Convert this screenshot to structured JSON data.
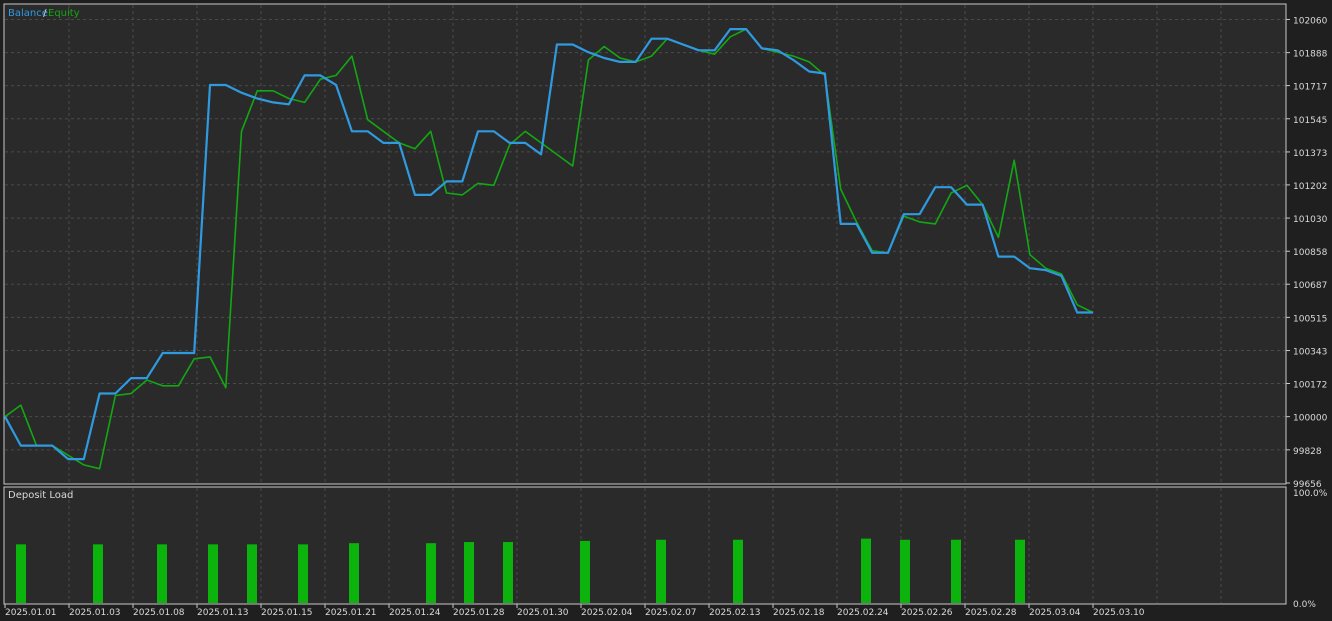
{
  "legend": {
    "balance": "Balance",
    "sep": " / ",
    "equity": "Equity"
  },
  "panel2_title": "Deposit Load",
  "colors": {
    "balance": "#2f9ae0",
    "equity": "#13a813",
    "bars": "#0db30d",
    "background": "#2a2a2a",
    "grid": "#4a4a4a",
    "text": "#d9d9d9"
  },
  "chart_data": [
    {
      "type": "line",
      "ylim": [
        99656,
        102135
      ],
      "y_ticks": [
        102060,
        101888,
        101717,
        101545,
        101373,
        101202,
        101030,
        100858,
        100687,
        100515,
        100343,
        100172,
        100000,
        99828,
        99656
      ],
      "grid": true,
      "legend_position": "top-left",
      "series": [
        {
          "name": "Balance",
          "values": [
            100000,
            99850,
            99850,
            99850,
            99780,
            99780,
            100120,
            100120,
            100200,
            100200,
            100330,
            100330,
            100330,
            101720,
            101720,
            101680,
            101650,
            101630,
            101620,
            101770,
            101770,
            101720,
            101480,
            101480,
            101420,
            101420,
            101150,
            101150,
            101220,
            101220,
            101480,
            101480,
            101420,
            101420,
            101360,
            101930,
            101930,
            101890,
            101860,
            101840,
            101840,
            101960,
            101960,
            101930,
            101900,
            101900,
            102010,
            102010,
            101910,
            101900,
            101850,
            101790,
            101780,
            101000,
            101000,
            100850,
            100850,
            101050,
            101050,
            101190,
            101190,
            101100,
            101100,
            100830,
            100830,
            100770,
            100760,
            100730,
            100540,
            100540
          ]
        },
        {
          "name": "Equity",
          "values": [
            100000,
            100060,
            99850,
            99850,
            99800,
            99750,
            99730,
            100110,
            100120,
            100190,
            100160,
            100160,
            100300,
            100310,
            100150,
            101480,
            101690,
            101690,
            101650,
            101630,
            101750,
            101770,
            101870,
            101540,
            101480,
            101420,
            101390,
            101480,
            101160,
            101150,
            101210,
            101200,
            101410,
            101480,
            101420,
            101360,
            101300,
            101850,
            101920,
            101860,
            101840,
            101870,
            101960,
            101930,
            101900,
            101880,
            101970,
            102010,
            101910,
            101890,
            101870,
            101840,
            101770,
            101180,
            101010,
            100860,
            100850,
            101040,
            101010,
            101000,
            101160,
            101200,
            101100,
            100930,
            101330,
            100840,
            100770,
            100740,
            100580,
            100540
          ]
        }
      ]
    },
    {
      "type": "bar",
      "title": "Deposit Load",
      "ylim": [
        0,
        100
      ],
      "y_ticks": [
        "100.0%",
        "0.0%"
      ],
      "values": [
        51,
        51,
        51,
        51,
        51,
        51,
        52,
        52,
        53,
        53,
        54,
        55,
        55,
        56,
        55,
        55,
        55
      ],
      "x_labels": [
        "2025.01.01",
        "2025.01.03",
        "2025.01.08",
        "2025.01.13",
        "2025.01.15",
        "2025.01.21",
        "2025.01.24",
        "2025.01.28",
        "2025.01.30",
        "2025.02.04",
        "2025.02.07",
        "2025.02.13",
        "2025.02.18",
        "2025.02.24",
        "2025.02.26",
        "2025.02.28",
        "2025.03.04",
        "2025.03.10"
      ]
    }
  ]
}
